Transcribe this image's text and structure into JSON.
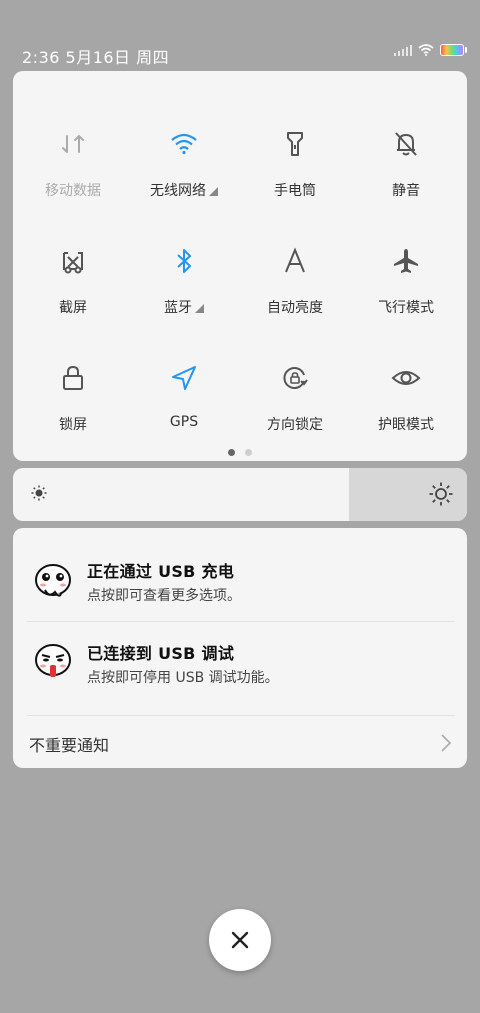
{
  "status_bar": {
    "time_date": "2:36  5月16日  周四"
  },
  "quick_tiles": [
    {
      "label": "移动数据",
      "icon": "mobile-data-icon",
      "active": false,
      "dim": true
    },
    {
      "label": "无线网络",
      "icon": "wifi-icon",
      "active": true,
      "has_more": true
    },
    {
      "label": "手电筒",
      "icon": "flashlight-icon",
      "active": false
    },
    {
      "label": "静音",
      "icon": "mute-bell-icon",
      "active": false
    },
    {
      "label": "截屏",
      "icon": "screenshot-icon",
      "active": false
    },
    {
      "label": "蓝牙",
      "icon": "bluetooth-icon",
      "active": true,
      "has_more": true
    },
    {
      "label": "自动亮度",
      "icon": "auto-brightness-icon",
      "active": false
    },
    {
      "label": "飞行模式",
      "icon": "airplane-icon",
      "active": false
    },
    {
      "label": "锁屏",
      "icon": "lock-icon",
      "active": false
    },
    {
      "label": "GPS",
      "icon": "gps-icon",
      "active": true
    },
    {
      "label": "方向锁定",
      "icon": "rotation-lock-icon",
      "active": false
    },
    {
      "label": "护眼模式",
      "icon": "eye-icon",
      "active": false
    }
  ],
  "pager": {
    "pages": 2,
    "current": 1
  },
  "brightness": {
    "level": 0.74
  },
  "notifications": [
    {
      "title": "正在通过 USB 充电",
      "subtitle": "点按即可查看更多选项。",
      "icon": "sticker-face-icon"
    },
    {
      "title": "已连接到 USB 调试",
      "subtitle": "点按即可停用 USB 调试功能。",
      "icon": "sticker-face-icon"
    }
  ],
  "unimportant": {
    "label": "不重要通知"
  },
  "colors": {
    "active": "#2196f3",
    "inactive": "#555555",
    "dim": "#aaaaaa"
  }
}
